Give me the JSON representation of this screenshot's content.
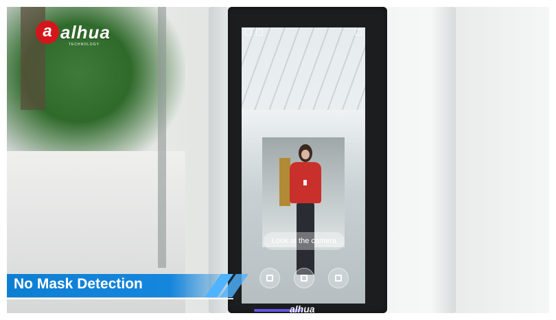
{
  "logo": {
    "text": "alhua",
    "subtext": "TECHNOLOGY"
  },
  "screen": {
    "prompt": "Look at the camera",
    "buttons": [
      {
        "icon": "grid-icon"
      },
      {
        "icon": "keypad-icon"
      },
      {
        "icon": "qr-code-icon"
      }
    ]
  },
  "device": {
    "brand": "alhua"
  },
  "caption": {
    "title": "No Mask Detection"
  },
  "colors": {
    "banner": "#1586dd",
    "accent": "#d4161c",
    "shirt": "#c9302c"
  }
}
